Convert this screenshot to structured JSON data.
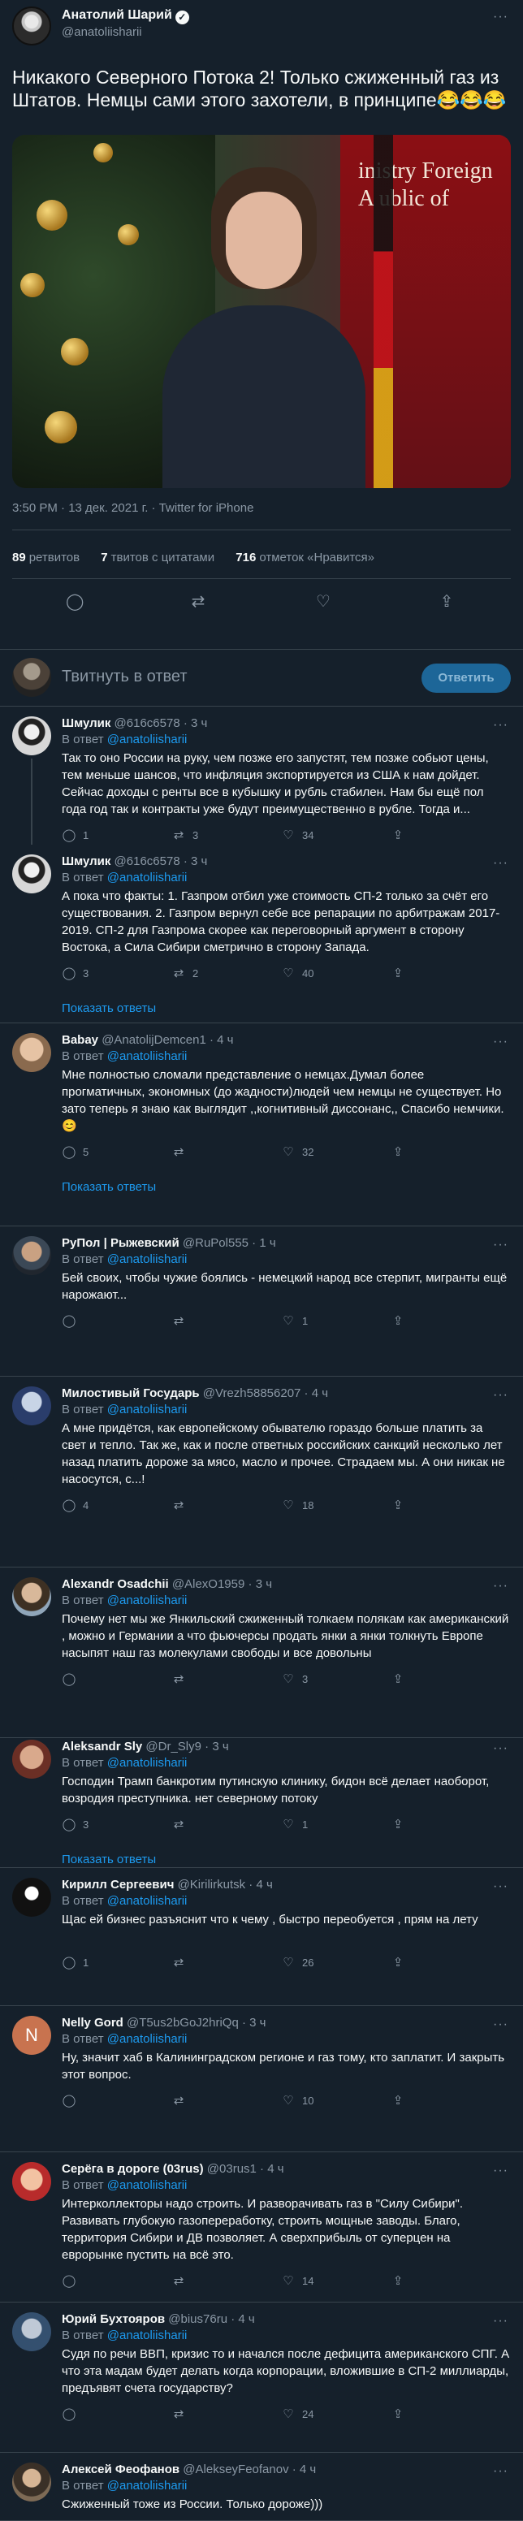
{
  "tweet": {
    "author_name": "Анатолий Шарий",
    "author_handle": "@anatoliisharii",
    "text": "Никакого Северного Потока 2! Только сжиженный газ из Штатов. Немцы сами этого захотели, в принципе😂😂😂",
    "image_wall_text": "inistry Foreign A ublic of",
    "timestamp": "3:50 PM · 13 дек. 2021 г. · Twitter for iPhone",
    "retweets_count": "89",
    "retweets_label": "ретвитов",
    "quotes_count": "7",
    "quotes_label": "твитов с цитатами",
    "likes_count": "716",
    "likes_label": "отметок «Нравится»"
  },
  "composer": {
    "placeholder": "Твитнуть в ответ",
    "button_label": "Ответить"
  },
  "replying_to_label": "В ответ",
  "replying_to_handle": "@anatoliisharii",
  "show_replies_label": "Показать ответы",
  "replies": [
    {
      "name": "Шмулик",
      "handle": "@616c6578",
      "time": "3 ч",
      "text": "Так то оно России на руку, чем позже его запустят, тем позже собьют цены, тем меньше шансов, что инфляция экспортируется из США к нам дойдет. Сейчас доходы с ренты все в кубышку и рубль стабилен. Нам бы ещё пол года год так и контракты уже будут преимущественно в рубле. Тогда и...",
      "replies": "1",
      "retweets": "3",
      "likes": "34"
    },
    {
      "name": "Шмулик",
      "handle": "@616c6578",
      "time": "3 ч",
      "text": "А пока что факты: 1. Газпром отбил уже стоимость СП-2 только за счёт его существования. 2. Газпром вернул себе все репарации по арбитражам 2017-2019. СП-2 для Газпрома скорее как переговорный аргумент в сторону Востока, а Сила Сибири сметрично в сторону Запада.",
      "replies": "3",
      "retweets": "2",
      "likes": "40"
    },
    {
      "name": "Babay",
      "handle": "@AnatolijDemcen1",
      "time": "4 ч",
      "text": "Мне полностью сломали представление о немцах.Думал более прогматичных, экономных (до жадности)людей чем немцы не существует. Но зато теперь я знаю как выглядит ,,когнитивный диссонанс,, Спасибо немчики.😊",
      "replies": "5",
      "retweets": "",
      "likes": "32"
    },
    {
      "name": "РуПол | Рыжевский",
      "handle": "@RuPol555",
      "time": "1 ч",
      "text": "Бей своих, чтобы чужие боялись - немецкий народ все стерпит, мигранты ещё нарожают...",
      "replies": "",
      "retweets": "",
      "likes": "1"
    },
    {
      "name": "Милостивый Государь",
      "handle": "@Vrezh58856207",
      "time": "4 ч",
      "text": "А мне придётся, как европейскому обывателю гораздо больше платить за свет и тепло. Так же, как и после ответных российских санкций несколько лет назад платить дороже за мясо, масло и прочее. Страдаем мы. А они никак не насосутся, с...!",
      "replies": "4",
      "retweets": "",
      "likes": "18"
    },
    {
      "name": "Alexandr Osadchii",
      "handle": "@AlexO1959",
      "time": "3 ч",
      "text": "Почему нет мы же Янкильский сжиженный толкаем полякам как американский , можно и Германии а что фьючерсы продать янки а янки толкнуть Европе насыпят наш газ молекулами свободы и все довольны",
      "replies": "",
      "retweets": "",
      "likes": "3"
    },
    {
      "name": "Aleksandr Sly",
      "handle": "@Dr_Sly9",
      "time": "3 ч",
      "text": "Господин Трамп банкротим путинскую клинику, бидон всё делает наоборот, возродия преступника. нет северному потоку",
      "replies": "3",
      "retweets": "",
      "likes": "1"
    },
    {
      "name": "Кирилл Сергеевич",
      "handle": "@Kirilirkutsk",
      "time": "4 ч",
      "text": "Щас ей бизнес разъяснит что к чему , быстро переобуется , прям на лету",
      "replies": "1",
      "retweets": "",
      "likes": "26"
    },
    {
      "name": "Nelly Gord",
      "handle": "@T5us2bGoJ2hriQq",
      "time": "3 ч",
      "text": "Ну, значит хаб в Калининградском регионе и газ тому, кто заплатит. И закрыть этот вопрос.",
      "replies": "",
      "retweets": "",
      "likes": "10"
    },
    {
      "name": "Серёга в дороге (03rus)",
      "handle": "@03rus1",
      "time": "4 ч",
      "text": "Интерколлекторы надо строить. И разворачивать газ в \"Силу Сибири\". Развивать глубокую газопереработку, строить мощные заводы. Благо, территория Сибири и ДВ позволяет. А сверхприбыль от суперцен на еврорынке пустить на всё это.",
      "replies": "",
      "retweets": "",
      "likes": "14"
    },
    {
      "name": "Юрий Бухтояров",
      "handle": "@bius76ru",
      "time": "4 ч",
      "text": "Судя по речи ВВП, кризис то и начался после дефицита американского СПГ. А что эта мадам будет делать когда корпорации, вложившие в СП-2 миллиарды, предъявят счета государству?",
      "replies": "",
      "retweets": "",
      "likes": "24"
    },
    {
      "name": "Алексей Феофанов",
      "handle": "@AlekseyFeofanov",
      "time": "4 ч",
      "text": "Сжиженный тоже из России. Только дороже)))",
      "replies": "",
      "retweets": "",
      "likes": ""
    }
  ],
  "colors": {
    "background": "#15202b",
    "text_primary": "#f7f9f9",
    "text_secondary": "#8b98a5",
    "accent": "#1d9bf0",
    "divider": "#38444d"
  }
}
